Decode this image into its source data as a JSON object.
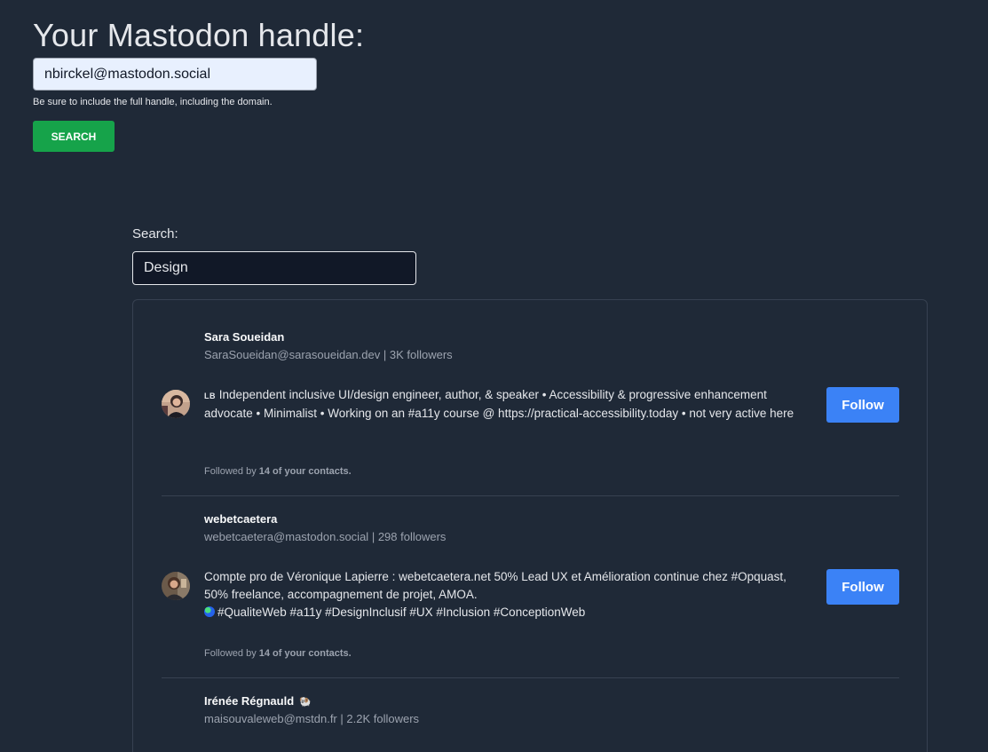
{
  "handle_form": {
    "title": "Your Mastodon handle:",
    "input_value": "nbirckel@mastodon.social",
    "hint": "Be sure to include the full handle, including the domain.",
    "search_label": "SEARCH"
  },
  "filter": {
    "label": "Search:",
    "value": "Design"
  },
  "results": [
    {
      "name": "Sara Soueidan",
      "handle": "SaraSoueidan@sarasoueidan.dev",
      "followers": "3K followers",
      "bio_tag": "LB",
      "bio": "Independent inclusive UI/design engineer, author, & speaker • Accessibility & progressive enhancement advocate • Minimalist • Working on an #a11y course @ https://practical-accessibility.today • not very active here",
      "followed_prefix": "Followed by",
      "followed_count": "14 of your contacts.",
      "follow_label": "Follow"
    },
    {
      "name": "webetcaetera",
      "handle": "webetcaetera@mastodon.social",
      "followers": "298 followers",
      "bio": "Compte pro de Véronique Lapierre : webetcaetera.net 50% Lead UX et Amélioration continue chez #Opquast, 50% freelance, accompagnement de projet, AMOA.",
      "bio_line2": "#QualiteWeb #a11y #DesignInclusif #UX #Inclusion #ConceptionWeb",
      "followed_prefix": "Followed by",
      "followed_count": "14 of your contacts.",
      "follow_label": "Follow"
    },
    {
      "name": "Irénée Régnauld",
      "handle": "maisouvaleweb@mstdn.fr",
      "followers": "2.2K followers",
      "name_icon": "bird-icon"
    }
  ],
  "handle_separator": "|",
  "colors": {
    "background": "#1f2937",
    "search_button": "#16a34a",
    "follow_button": "#3b82f6"
  }
}
